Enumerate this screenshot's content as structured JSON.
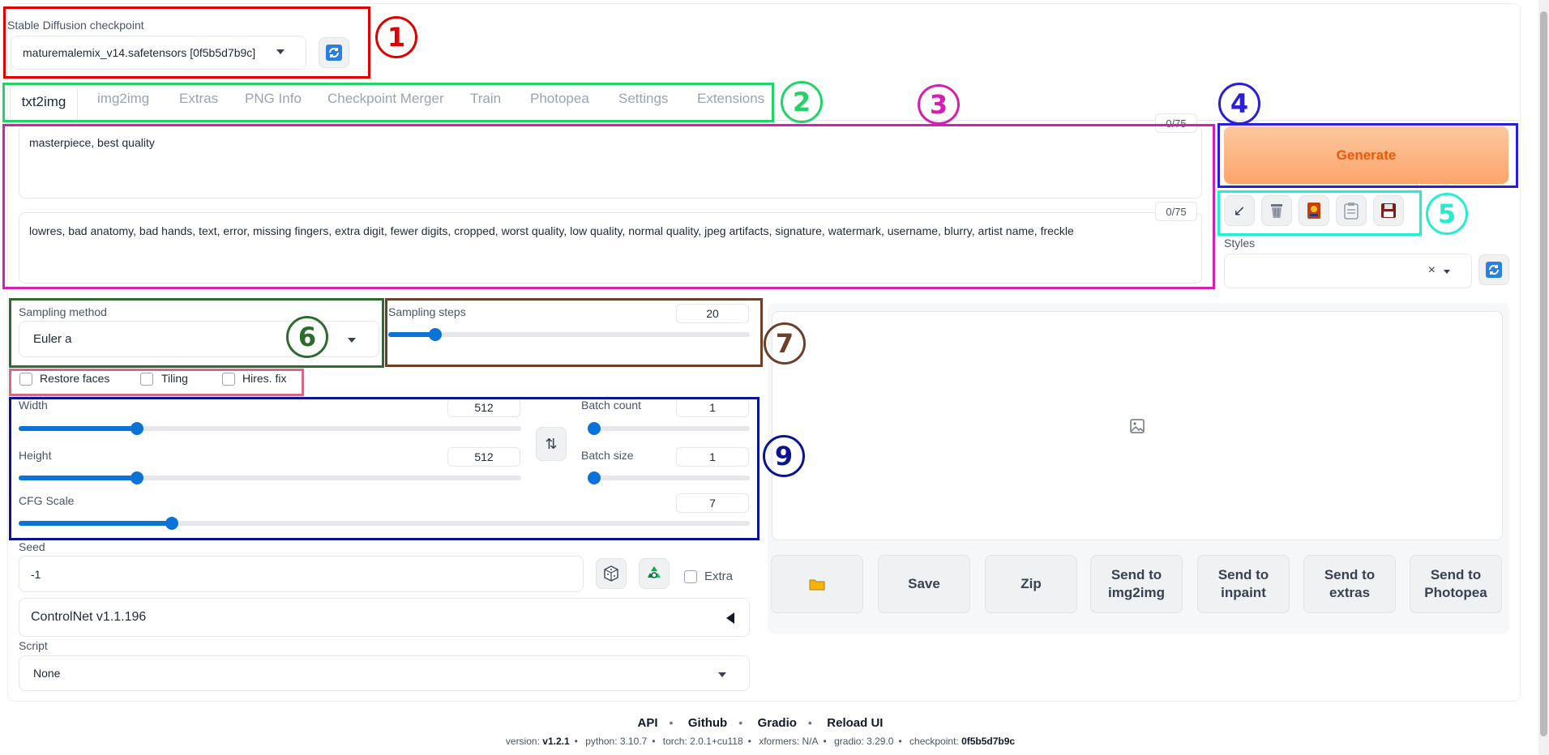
{
  "checkpoint": {
    "label": "Stable Diffusion checkpoint",
    "value": "maturemalemix_v14.safetensors [0f5b5d7b9c]"
  },
  "tabs": [
    "txt2img",
    "img2img",
    "Extras",
    "PNG Info",
    "Checkpoint Merger",
    "Train",
    "Photopea",
    "Settings",
    "Extensions"
  ],
  "active_tab": "txt2img",
  "prompt": {
    "positive": "masterpiece, best quality",
    "positive_count": "0/75",
    "negative": "lowres, bad anatomy, bad hands, text, error, missing fingers, extra digit, fewer digits, cropped, worst quality, low quality, normal quality, jpeg artifacts, signature, watermark, username, blurry, artist name, freckle",
    "negative_count": "0/75"
  },
  "generate_label": "Generate",
  "tool_icons": [
    "arrow-icon",
    "trash-icon",
    "card-icon",
    "clipboard-icon",
    "save-icon"
  ],
  "styles": {
    "label": "Styles",
    "clear": "×"
  },
  "sampling": {
    "method_label": "Sampling method",
    "method_value": "Euler a",
    "steps_label": "Sampling steps",
    "steps_value": "20",
    "steps_fraction": 0.13
  },
  "options": {
    "restore_faces": "Restore faces",
    "tiling": "Tiling",
    "hires_fix": "Hires. fix"
  },
  "dims": {
    "width_label": "Width",
    "width_value": "512",
    "width_fraction": 0.235,
    "height_label": "Height",
    "height_value": "512",
    "height_fraction": 0.235,
    "batch_count_label": "Batch count",
    "batch_count_value": "1",
    "batch_count_fraction": 0.0,
    "batch_size_label": "Batch size",
    "batch_size_value": "1",
    "batch_size_fraction": 0.0,
    "cfg_label": "CFG Scale",
    "cfg_value": "7",
    "cfg_fraction": 0.21
  },
  "seed": {
    "label": "Seed",
    "value": "-1",
    "extra_label": "Extra"
  },
  "controlnet": {
    "label": "ControlNet v1.1.196"
  },
  "script": {
    "label": "Script",
    "value": "None"
  },
  "output_buttons": [
    "",
    "Save",
    "Zip",
    "Send to\nimg2img",
    "Send to\ninpaint",
    "Send to\nextras",
    "Send to\nPhotopea"
  ],
  "annotations": [
    "1",
    "2",
    "3",
    "4",
    "5",
    "6",
    "7",
    "9"
  ],
  "footer": {
    "links": [
      "API",
      "Github",
      "Gradio",
      "Reload UI"
    ],
    "version_label": "version:",
    "version": "v1.2.1",
    "python": "python: 3.10.7",
    "torch": "torch: 2.0.1+cu118",
    "xformers": "xformers: N/A",
    "gradio": "gradio: 3.29.0",
    "checkpoint_label": "checkpoint:",
    "checkpoint": "0f5b5d7b9c"
  },
  "colors": {
    "accent_blue": "#0b72d8",
    "generate_orange": "#fdb27a",
    "generate_text": "#ea580c",
    "anno_red": "#e00000",
    "anno_green": "#22d36a",
    "anno_magenta": "#d41fb0",
    "anno_indigo": "#2a1ed6",
    "anno_cyan": "#22eed0",
    "anno_darkgreen": "#2f6b2f",
    "anno_brown": "#6b3f2a",
    "anno_pink": "#d46a8a",
    "anno_navy": "#0b1490"
  }
}
